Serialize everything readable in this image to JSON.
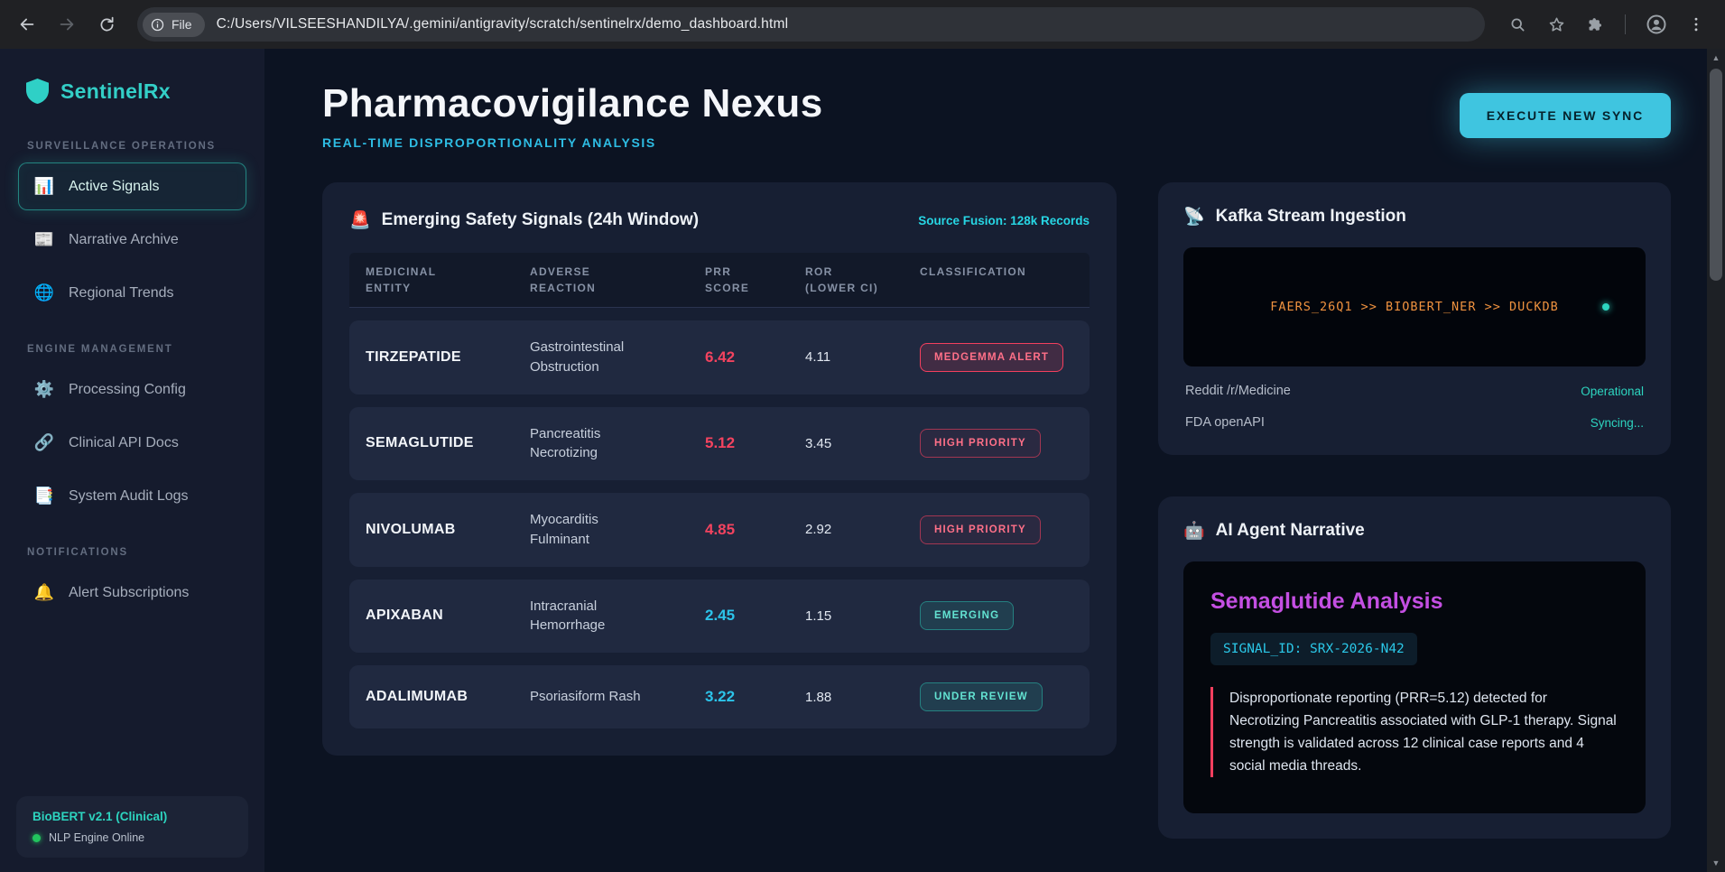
{
  "colors": {
    "accent_teal": "#2dd4bf",
    "accent_cyan": "#22d3ee",
    "alert_red": "#f43f5e",
    "magenta": "#c44fe2",
    "terminal_orange": "#f0923f",
    "status_green": "#22c55e"
  },
  "browser": {
    "file_chip": "File",
    "url": "C:/Users/VILSEESHANDILYA/.gemini/antigravity/scratch/sentinelrx/demo_dashboard.html"
  },
  "sidebar": {
    "brand": "SentinelRx",
    "sections": [
      {
        "heading": "SURVEILLANCE OPERATIONS",
        "items": [
          {
            "label": "Active Signals",
            "icon": "📊"
          },
          {
            "label": "Narrative Archive",
            "icon": "📰"
          },
          {
            "label": "Regional Trends",
            "icon": "🌐"
          }
        ]
      },
      {
        "heading": "ENGINE MANAGEMENT",
        "items": [
          {
            "label": "Processing Config",
            "icon": "⚙️"
          },
          {
            "label": "Clinical API Docs",
            "icon": "🔗"
          },
          {
            "label": "System Audit Logs",
            "icon": "📑"
          }
        ]
      },
      {
        "heading": "NOTIFICATIONS",
        "items": [
          {
            "label": "Alert Subscriptions",
            "icon": "🔔"
          }
        ]
      }
    ],
    "footer_title": "BioBERT v2.1 (Clinical)",
    "footer_status": "NLP Engine Online"
  },
  "header": {
    "title": "Pharmacovigilance Nexus",
    "subtitle": "REAL-TIME DISPROPORTIONALITY ANALYSIS",
    "sync_button": "EXECUTE NEW SYNC"
  },
  "signals": {
    "icon": "🚨",
    "title": "Emerging Safety Signals (24h Window)",
    "source": "Source Fusion: 128k Records",
    "columns": [
      "MEDICINAL\nENTITY",
      "ADVERSE\nREACTION",
      "PRR\nSCORE",
      "ROR\n(LOWER CI)",
      "CLASSIFICATION"
    ],
    "rows": [
      {
        "entity": "TIRZEPATIDE",
        "reaction": "Gastrointestinal\nObstruction",
        "prr": "6.42",
        "ror": "4.11",
        "badge": "MEDGEMMA ALERT"
      },
      {
        "entity": "SEMAGLUTIDE",
        "reaction": "Pancreatitis\nNecrotizing",
        "prr": "5.12",
        "ror": "3.45",
        "badge": "HIGH PRIORITY"
      },
      {
        "entity": "NIVOLUMAB",
        "reaction": "Myocarditis\nFulminant",
        "prr": "4.85",
        "ror": "2.92",
        "badge": "HIGH PRIORITY"
      },
      {
        "entity": "APIXABAN",
        "reaction": "Intracranial\nHemorrhage",
        "prr": "2.45",
        "ror": "1.15",
        "badge": "EMERGING"
      },
      {
        "entity": "ADALIMUMAB",
        "reaction": "Psoriasiform Rash",
        "prr": "3.22",
        "ror": "1.88",
        "badge": "UNDER REVIEW"
      }
    ]
  },
  "kafka": {
    "icon": "📡",
    "title": "Kafka Stream Ingestion",
    "terminal": "FAERS_26Q1 >> BIOBERT_NER >> DUCKDB",
    "streams": [
      {
        "name": "Reddit /r/Medicine",
        "status": "Operational"
      },
      {
        "name": "FDA openAPI",
        "status": "Syncing..."
      }
    ]
  },
  "narrative": {
    "icon": "🤖",
    "title": "AI Agent Narrative",
    "analysis_title": "Semaglutide Analysis",
    "signal_id": "SIGNAL_ID: SRX-2026-N42",
    "body": "Disproportionate reporting (PRR=5.12) detected for Necrotizing Pancreatitis associated with GLP-1 therapy. Signal strength is validated across 12 clinical case reports and 4 social media threads."
  }
}
